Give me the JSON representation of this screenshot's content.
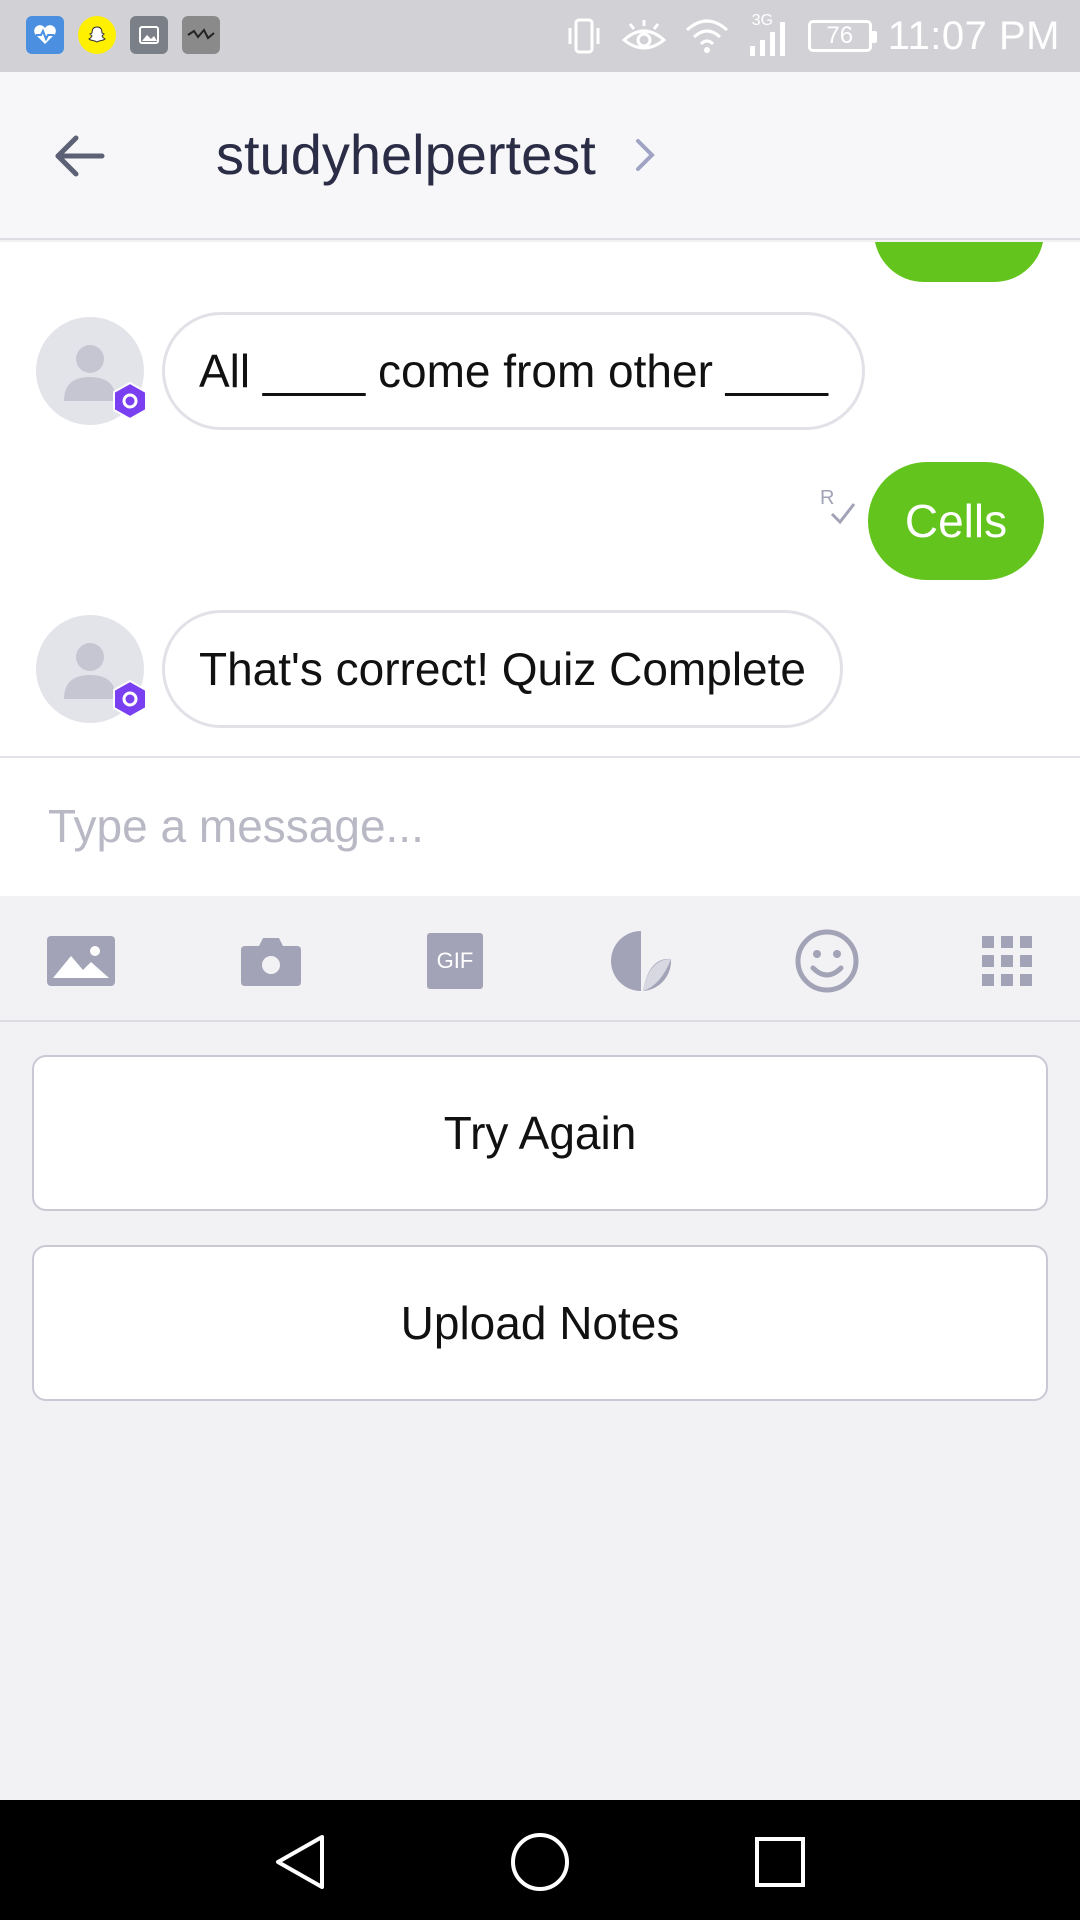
{
  "status_bar": {
    "time": "11:07 PM",
    "battery": "76",
    "network": "3G"
  },
  "header": {
    "title": "studyhelpertest"
  },
  "messages": [
    {
      "from": "bot",
      "text": "All ____ come from other ____"
    },
    {
      "from": "user",
      "text": "Cells"
    },
    {
      "from": "bot",
      "text": "That's correct! Quiz Complete"
    }
  ],
  "input": {
    "placeholder": "Type a message..."
  },
  "toolbar": {
    "gif_label": "GIF",
    "items": [
      "image-icon",
      "camera-icon",
      "gif-icon",
      "sticker-icon",
      "emoji-icon",
      "apps-grid-icon"
    ]
  },
  "quick_replies": {
    "try_again": "Try Again",
    "upload_notes": "Upload Notes"
  },
  "colors": {
    "accent_green": "#62c41c",
    "badge_purple": "#7b3ff2",
    "icon_gray": "#a3a3b8"
  }
}
